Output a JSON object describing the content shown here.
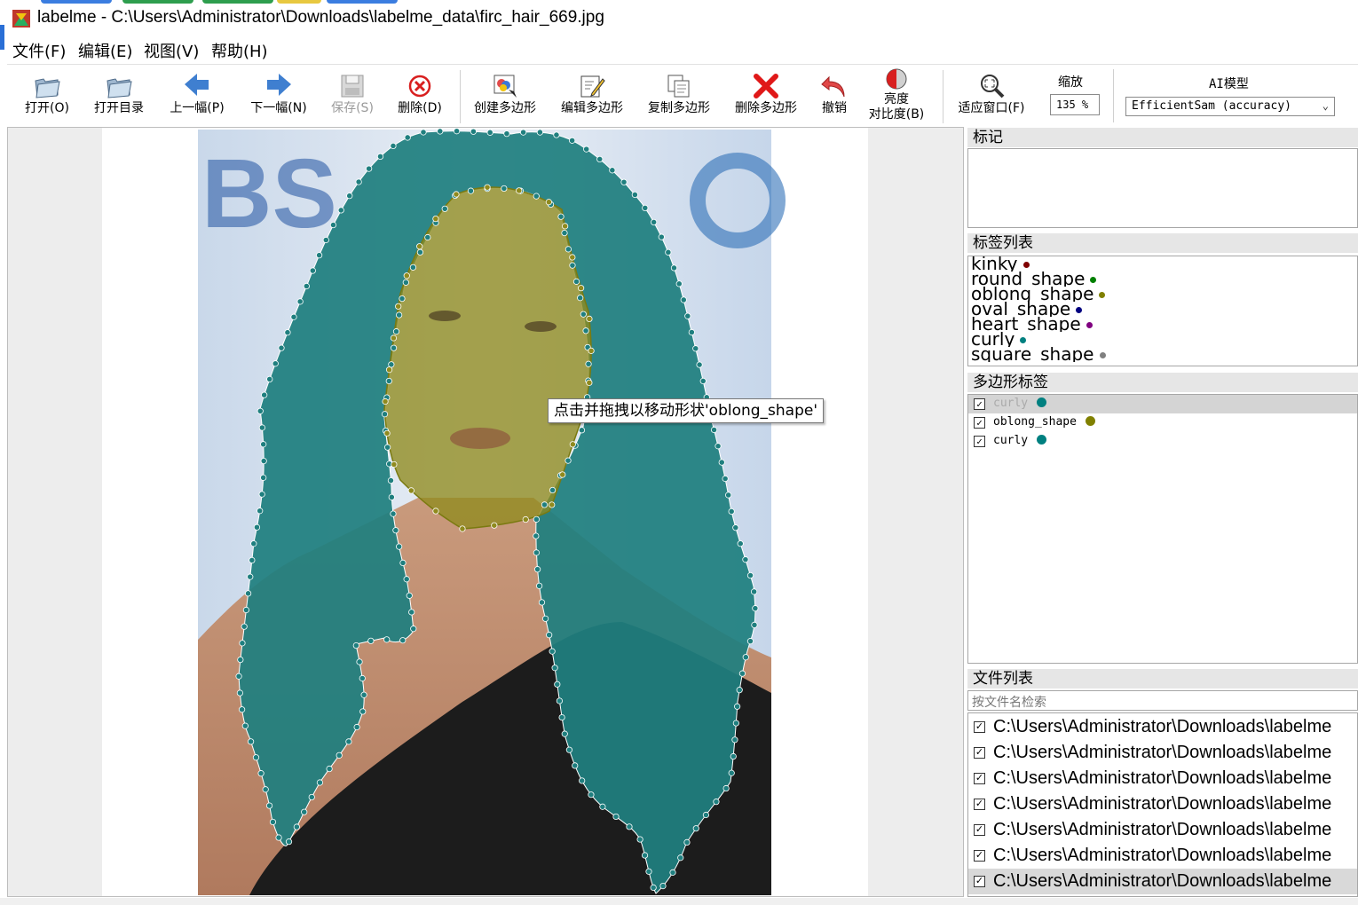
{
  "window": {
    "title": "labelme - C:\\Users\\Administrator\\Downloads\\labelme_data\\firc_hair_669.jpg"
  },
  "menu": [
    "文件(F)",
    "编辑(E)",
    "视图(V)",
    "帮助(H)"
  ],
  "toolbar": {
    "open": "打开(O)",
    "open_dir": "打开目录",
    "prev": "上一幅(P)",
    "next": "下一幅(N)",
    "save": "保存(S)",
    "delete": "删除(D)",
    "create_polygon": "创建多边形",
    "edit_polygon": "编辑多边形",
    "copy_polygon": "复制多边形",
    "delete_polygon": "删除多边形",
    "undo": "撤销",
    "brightness_1": "亮度",
    "brightness_2": "对比度(B)",
    "fit_window": "适应窗口(F)",
    "zoom_label": "缩放",
    "zoom_value": "135 %",
    "ai_label": "AI模型",
    "ai_value": "EfficientSam (accuracy)"
  },
  "canvas": {
    "tooltip": "点击并拖拽以移动形状'oblong_shape'",
    "hair_color": "#1f7f7f",
    "face_color": "#8f8a1e"
  },
  "docks": {
    "flags_title": "标记",
    "label_list_title": "标签列表",
    "polygon_labels_title": "多边形标签",
    "file_list_title": "文件列表",
    "file_search_placeholder": "按文件名检索"
  },
  "label_list": [
    {
      "name": "kinky",
      "color": "#800000"
    },
    {
      "name": "round_shape",
      "color": "#008000"
    },
    {
      "name": "oblong_shape",
      "color": "#808000"
    },
    {
      "name": "oval_shape",
      "color": "#000080"
    },
    {
      "name": "heart_shape",
      "color": "#800080"
    },
    {
      "name": "curly",
      "color": "#008080"
    },
    {
      "name": "square_shape",
      "color": "#808080"
    }
  ],
  "polygon_labels": [
    {
      "name": "curly",
      "color": "#008080",
      "checked": true,
      "selected": true
    },
    {
      "name": "oblong_shape",
      "color": "#808000",
      "checked": true,
      "selected": false
    },
    {
      "name": "curly",
      "color": "#008080",
      "checked": true,
      "selected": false
    }
  ],
  "files": [
    {
      "path": "C:\\Users\\Administrator\\Downloads\\labelme",
      "checked": true
    },
    {
      "path": "C:\\Users\\Administrator\\Downloads\\labelme",
      "checked": true
    },
    {
      "path": "C:\\Users\\Administrator\\Downloads\\labelme",
      "checked": true
    },
    {
      "path": "C:\\Users\\Administrator\\Downloads\\labelme",
      "checked": true
    },
    {
      "path": "C:\\Users\\Administrator\\Downloads\\labelme",
      "checked": true
    },
    {
      "path": "C:\\Users\\Administrator\\Downloads\\labelme",
      "checked": true
    },
    {
      "path": "C:\\Users\\Administrator\\Downloads\\labelme",
      "checked": true
    }
  ]
}
